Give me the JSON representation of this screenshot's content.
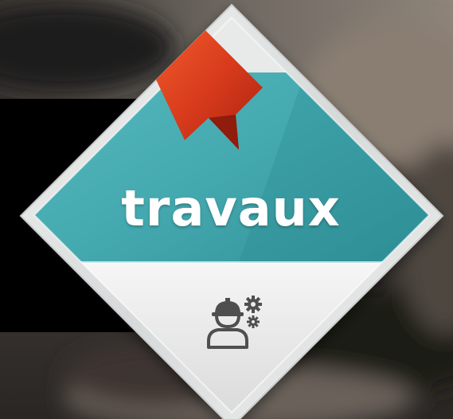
{
  "badge": {
    "title": "travaux",
    "icon": "worker-with-gears-icon",
    "ribbon_icon": "bookmark-ribbon-icon"
  },
  "colors": {
    "teal": "#4bb0b6",
    "teal_dark": "#2f8e95",
    "ribbon": "#d93a1c",
    "ribbon_dark": "#9e1f10",
    "frame": "#e4e6e6",
    "panel_light": "#ececec",
    "icon": "#4f4f4f"
  }
}
